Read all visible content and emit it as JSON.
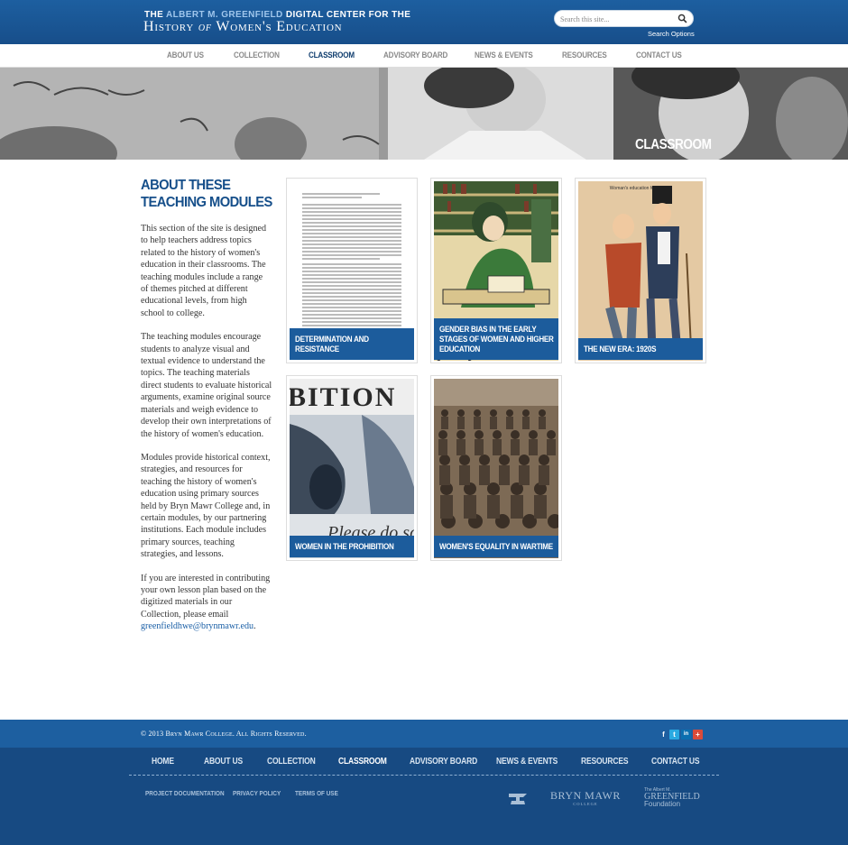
{
  "header": {
    "logo_pre": "The",
    "logo_name": "Albert M. Greenfield",
    "logo_mid": "Digital Center for the",
    "logo_history": "History",
    "logo_of": "of",
    "logo_rest": "Women's Education",
    "search_placeholder": "Search this site...",
    "search_options": "Search Options"
  },
  "nav": {
    "items": [
      "About Us",
      "Collection",
      "Classroom",
      "Advisory Board",
      "News & Events",
      "Resources",
      "Contact Us"
    ],
    "active": "Classroom"
  },
  "hero": {
    "title": "Classroom"
  },
  "sidebar": {
    "title": "About These Teaching Modules",
    "p1": "This section of the site is designed to help teachers address topics related to the history of women's education in their classrooms. The teaching modules include a range of themes pitched at different educational levels, from high school to college.",
    "p2": "The teaching modules encourage students to analyze visual and textual evidence to understand the topics. The teaching materials direct students to evaluate historical arguments, examine original source materials and weigh evidence to develop their own interpretations of the history of women's education.",
    "p3": "Modules provide historical context, strategies, and resources for teaching the history of women's education using primary sources held by Bryn Mawr College and, in certain modules, by our partnering institutions. Each module includes primary sources, teaching strategies, and lessons.",
    "p4": "If you are interested in contributing your own lesson plan based on the digitized materials in our Collection, please email",
    "email": "greenfieldhwe@brynmawr.edu",
    "p4_end": "."
  },
  "modules": [
    {
      "caption": "Determination and Resistance"
    },
    {
      "caption": "Gender Bias in the Early Stages of Women and Higher Education"
    },
    {
      "caption": "The New Era: 1920s"
    },
    {
      "caption": "Women in the Prohibition"
    },
    {
      "caption": "Women's Equality in Wartime"
    }
  ],
  "images": {
    "poster_top": "Woman's education for women",
    "sign_text": "Please do so",
    "sign_banner": "BITION"
  },
  "footer": {
    "copyright": "© 2013 Bryn Mawr College. All Rights Reserved.",
    "nav": [
      "Home",
      "About Us",
      "Collection",
      "Classroom",
      "Advisory Board",
      "News & Events",
      "Resources",
      "Contact Us"
    ],
    "sub": [
      "Project Documentation",
      "Privacy Policy",
      "Terms of Use"
    ],
    "brynmawr": "BRYN MAWR",
    "college": "COLLEGE",
    "foundation_l1": "The Albert M.",
    "foundation_l2": "GREENFIELD",
    "foundation_l3": "Foundation",
    "social": [
      "f",
      "t",
      "in",
      "+"
    ]
  },
  "colors": {
    "brand_blue": "#1d5fa0",
    "footer_blue": "#174a82",
    "caption_blue": "#1c5c9c"
  }
}
